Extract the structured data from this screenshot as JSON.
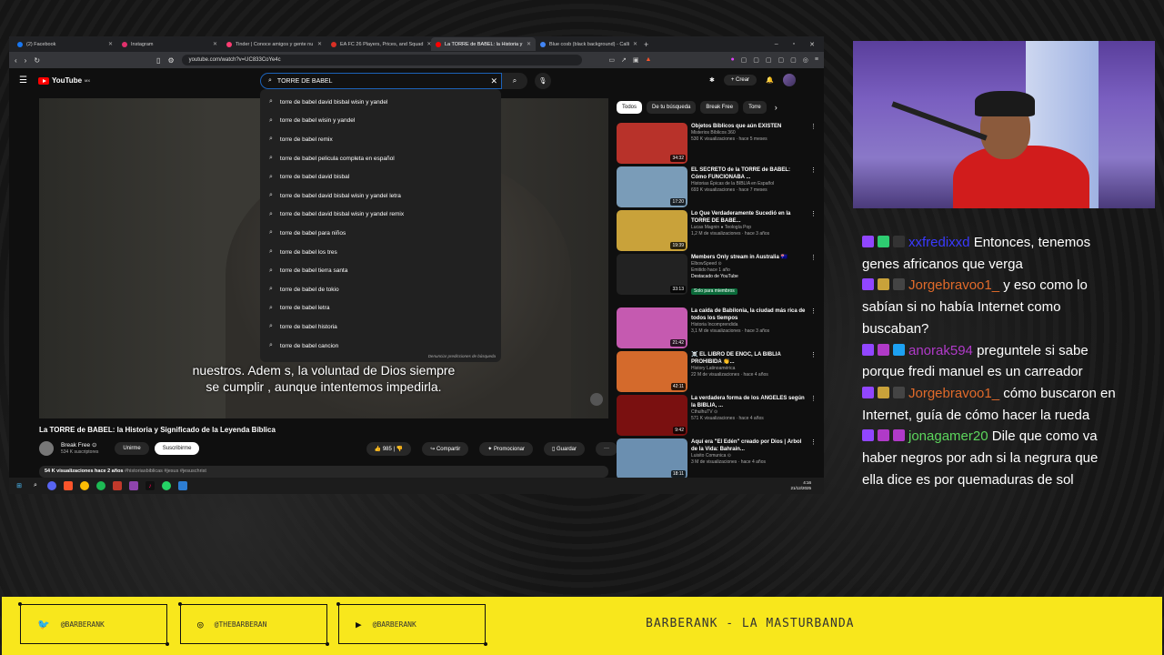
{
  "browser": {
    "tabs": [
      {
        "label": "(2) Facebook",
        "color": "#1877f2"
      },
      {
        "label": "Instagram",
        "color": "#e1306c"
      },
      {
        "label": "Tinder | Conoce amigos y gente nu",
        "color": "#fe3c72"
      },
      {
        "label": "EA FC 26 Players, Prices, and Squad",
        "color": "#d93025"
      },
      {
        "label": "La TORRE de BABEL: la Historia y",
        "color": "#ff0000"
      },
      {
        "label": "Blue cosb (black background) - Calli",
        "color": "#4285f4"
      }
    ],
    "url": "youtube.com/watch?v=UC833CoYe4c"
  },
  "youtube": {
    "logo": "YouTube",
    "logo_suffix": "MX",
    "search_value": "TORRE DE BABEL",
    "create_label": "Crear",
    "suggestions": [
      "torre de babel david bisbal wisin y yandel",
      "torre de babel wisin y yandel",
      "torre de babel remix",
      "torre de babel pelicula completa en español",
      "torre de babel david bisbal",
      "torre de babel david bisbal wisin y yandel letra",
      "torre de babel david bisbal wisin y yandel remix",
      "torre de babel para niños",
      "torre de babel los tres",
      "torre de babel tierra santa",
      "torre de babel de tokio",
      "torre de babel letra",
      "torre de babel historia",
      "torre de babel cancion"
    ],
    "suggestions_footer": "Denunciar predicciones de búsqueda",
    "subtitle_line1": "nuestros. Adem s, la voluntad de Dios siempre",
    "subtitle_line2": "se cumplir , aunque intentemos impedirla.",
    "video_title": "La TORRE de BABEL: la Historia y Significado de la Leyenda Bíblica",
    "channel_name": "Break Free ⊙",
    "channel_subs": "534 K suscriptores",
    "join_label": "Unirme",
    "subscribe_label": "Suscribirme",
    "likes": "985",
    "share_label": "Compartir",
    "promote_label": "Promocionar",
    "save_label": "Guardar",
    "description_meta": "54 K visualizaciones  hace 2 años",
    "description_tags": "#historiasbiblicas #jesus #jesuschrist",
    "chips": [
      "Todos",
      "De tu búsqueda",
      "Break Free",
      "Torre"
    ],
    "related": [
      {
        "title": "Objetos Bíblicos que aún EXISTEN",
        "channel": "Misterios Bíblicos 360",
        "meta": "530 K visualizaciones · hace 5 meses",
        "duration": "34:32",
        "color": "#b8322a"
      },
      {
        "title": "EL SECRETO de la TORRE de BABEL: Cómo FUNCIONABA ...",
        "channel": "Historias Épicas de la BIBLIA en Español",
        "meta": "693 K visualizaciones · hace 7 meses",
        "duration": "17:20",
        "color": "#7a9cb8"
      },
      {
        "title": "Lo Que Verdaderamente Sucedió en la TORRE DE BABE...",
        "channel": "Lucas Magnin ● Teología Pop",
        "meta": "1,2 M de visualizaciones · hace 3 años",
        "duration": "19:39",
        "color": "#c9a23a"
      },
      {
        "title": "Members Only stream in Australia 🇦🇺",
        "channel": "ElbowSpeed ⊙",
        "meta": "Emitido hace 1 año",
        "extra": "Destacado de YouTube",
        "badge": "Solo para miembros",
        "duration": "33:13",
        "color": "#222222"
      },
      {
        "title": "La caída de Babilonia, la ciudad más rica de todos los tiempos",
        "channel": "Historia Incomprendida",
        "meta": "3,1 M de visualizaciones · hace 3 años",
        "duration": "21:42",
        "color": "#c55ab0"
      },
      {
        "title": "☠️ EL LIBRO DE ENOC, LA BIBLIA PROHIBIDA 👏...",
        "channel": "History Latinoamérica",
        "meta": "22 M de visualizaciones · hace 4 años",
        "duration": "42:11",
        "color": "#d46a2c"
      },
      {
        "title": "La verdadera forma de los ÁNGELES según la BIBLIA, ...",
        "channel": "CthulhuTV ⊙",
        "meta": "571 K visualizaciones · hace 4 años",
        "duration": "9:42",
        "color": "#7a1010"
      },
      {
        "title": "Aquí era \"El Edén\" creado por Dios | Árbol de la Vida: Bahrain...",
        "channel": "Luisito Comunica ⊙",
        "meta": "3 M de visualizaciones · hace 4 años",
        "duration": "18:11",
        "color": "#6b8fb0"
      }
    ]
  },
  "taskbar": {
    "time": "4:16",
    "date": "21/12/2025"
  },
  "chat": [
    {
      "user": "xxfredixxd",
      "text": "Entonces, tenemos genes africanos que verga",
      "color": "#3a3aff"
    },
    {
      "user": "Jorgebravoo1_",
      "text": "y eso como lo sabían si no había Internet como buscaban?",
      "color": "#e06a2a"
    },
    {
      "user": "anorak594",
      "text": "preguntele si sabe porque fredi manuel es un carreador",
      "color": "#b03ac8"
    },
    {
      "user": "Jorgebravoo1_",
      "text": "cómo buscaron en Internet, guía de cómo hacer la rueda",
      "color": "#e06a2a"
    },
    {
      "user": "jonagamer20",
      "text": "Dile que como va haber negros por adn si la negrura que ella dice es por quemaduras de sol",
      "color": "#5cd65c"
    }
  ],
  "footer": {
    "twitter": "@BARBERANK",
    "instagram": "@THEBARBERAN",
    "youtube": "@BARBERANK",
    "tagline": "BARBERANK - LA MASTURBANDA"
  }
}
